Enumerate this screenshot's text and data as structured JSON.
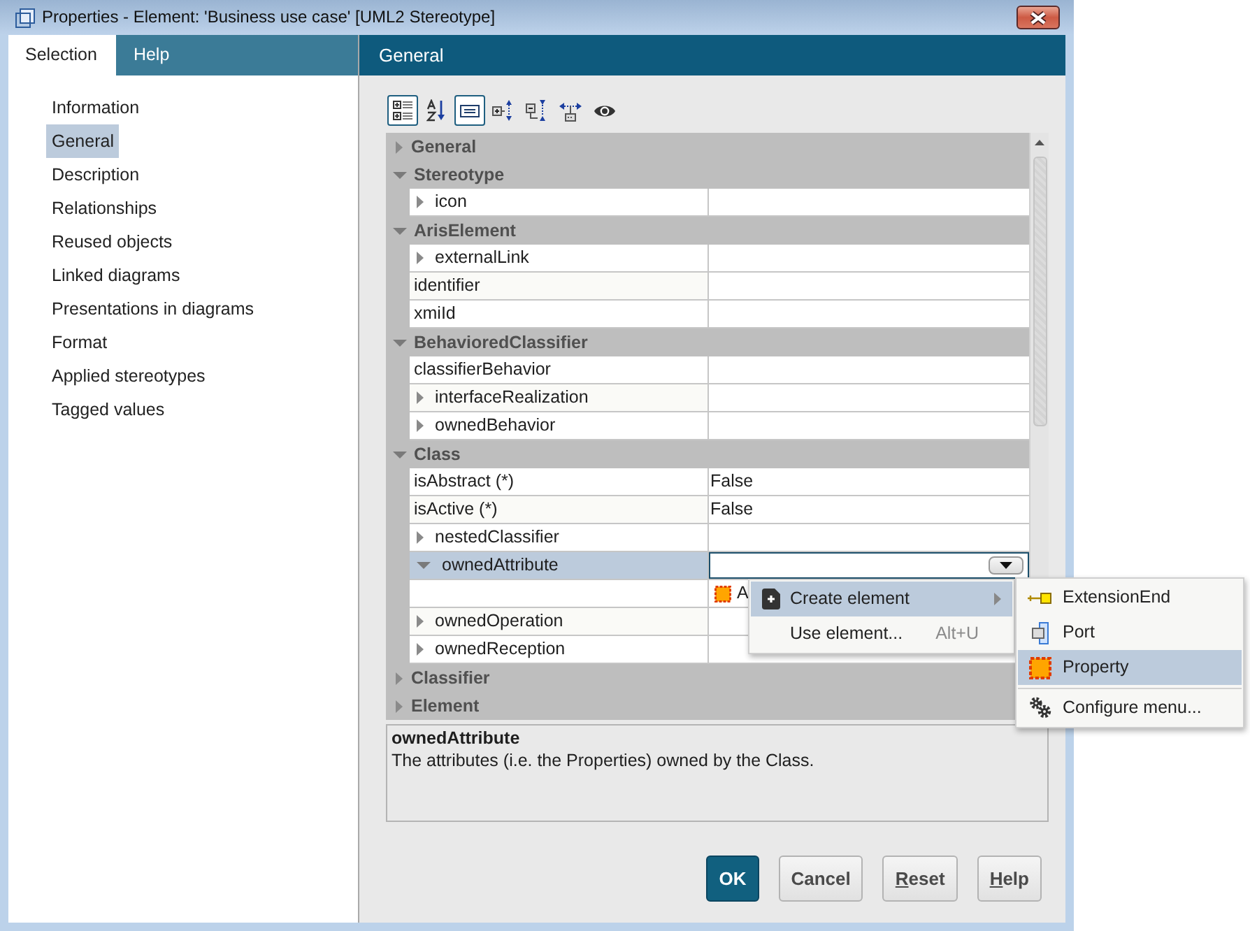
{
  "window": {
    "title": "Properties - Element: 'Business use case' [UML2 Stereotype]"
  },
  "tabs": [
    {
      "label": "Selection",
      "selected": true
    },
    {
      "label": "Help",
      "selected": false
    }
  ],
  "navigation": [
    {
      "label": "Information",
      "selected": false
    },
    {
      "label": "General",
      "selected": true
    },
    {
      "label": "Description",
      "selected": false
    },
    {
      "label": "Relationships",
      "selected": false
    },
    {
      "label": "Reused objects",
      "selected": false
    },
    {
      "label": "Linked diagrams",
      "selected": false
    },
    {
      "label": "Presentations in diagrams",
      "selected": false
    },
    {
      "label": "Format",
      "selected": false
    },
    {
      "label": "Applied stereotypes",
      "selected": false
    },
    {
      "label": "Tagged values",
      "selected": false
    }
  ],
  "panel": {
    "title": "General"
  },
  "toolbar": [
    {
      "kind": "categorized",
      "selected": true
    },
    {
      "kind": "sort",
      "selected": false
    },
    {
      "kind": "description",
      "selected": true
    },
    {
      "kind": "expand",
      "selected": false
    },
    {
      "kind": "collapse",
      "selected": false
    },
    {
      "kind": "move",
      "selected": false
    },
    {
      "kind": "view",
      "selected": false
    }
  ],
  "grid": [
    {
      "label": "General",
      "expanded": false
    },
    {
      "label": "Stereotype",
      "expanded": true,
      "children": [
        {
          "kind": "group",
          "name": "icon",
          "expanded": false,
          "selected": false
        }
      ]
    },
    {
      "label": "ArisElement",
      "expanded": true,
      "children": [
        {
          "kind": "group",
          "name": "externalLink",
          "expanded": false,
          "selected": false
        },
        {
          "kind": "plain",
          "name": "identifier",
          "selected": false
        },
        {
          "kind": "plain",
          "name": "xmiId",
          "selected": false
        }
      ]
    },
    {
      "label": "BehavioredClassifier",
      "expanded": true,
      "children": [
        {
          "kind": "plain",
          "name": "classifierBehavior",
          "selected": false
        },
        {
          "kind": "group",
          "name": "interfaceRealization",
          "expanded": false,
          "selected": false
        },
        {
          "kind": "group",
          "name": "ownedBehavior",
          "expanded": false,
          "selected": false
        }
      ]
    },
    {
      "label": "Class",
      "expanded": true,
      "children": [
        {
          "kind": "plain",
          "name": "isAbstract (*)",
          "value": "False",
          "selected": false
        },
        {
          "kind": "plain",
          "name": "isActive (*)",
          "value": "False",
          "selected": false
        },
        {
          "kind": "group",
          "name": "nestedClassifier",
          "expanded": false,
          "selected": false
        },
        {
          "kind": "group",
          "name": "ownedAttribute",
          "expanded": true,
          "selected": true,
          "children": [
            {
              "kind": "element",
              "value": "A",
              "selected": false
            }
          ]
        },
        {
          "kind": "group",
          "name": "ownedOperation",
          "expanded": false,
          "selected": false
        },
        {
          "kind": "group",
          "name": "ownedReception",
          "expanded": false,
          "selected": false
        }
      ]
    },
    {
      "label": "Classifier",
      "expanded": false
    },
    {
      "label": "Element",
      "expanded": false
    }
  ],
  "description": {
    "title": "ownedAttribute",
    "text": "The attributes (i.e. the Properties) owned by the Class."
  },
  "context_menu": [
    {
      "kind": "create",
      "label": "Create element",
      "has_submenu": true,
      "selected": true
    },
    {
      "kind": "plain",
      "label": "Use element...",
      "shortcut": "Alt+U",
      "has_submenu": false,
      "selected": false
    }
  ],
  "submenu": [
    {
      "kind": "extension-end",
      "label": "ExtensionEnd",
      "separator_before": false,
      "selected": false
    },
    {
      "kind": "port",
      "label": "Port",
      "separator_before": false,
      "selected": false
    },
    {
      "kind": "property",
      "label": "Property",
      "separator_before": false,
      "selected": true
    },
    {
      "kind": "configure",
      "label": "Configure menu...",
      "separator_before": true,
      "selected": false
    }
  ],
  "buttons": [
    {
      "label": "OK",
      "default": true,
      "mnemonic": false
    },
    {
      "label": "Cancel",
      "default": false,
      "mnemonic": false
    },
    {
      "label": "Reset",
      "default": false,
      "mnemonic": true
    },
    {
      "label": "Help",
      "default": false,
      "mnemonic": true
    }
  ]
}
